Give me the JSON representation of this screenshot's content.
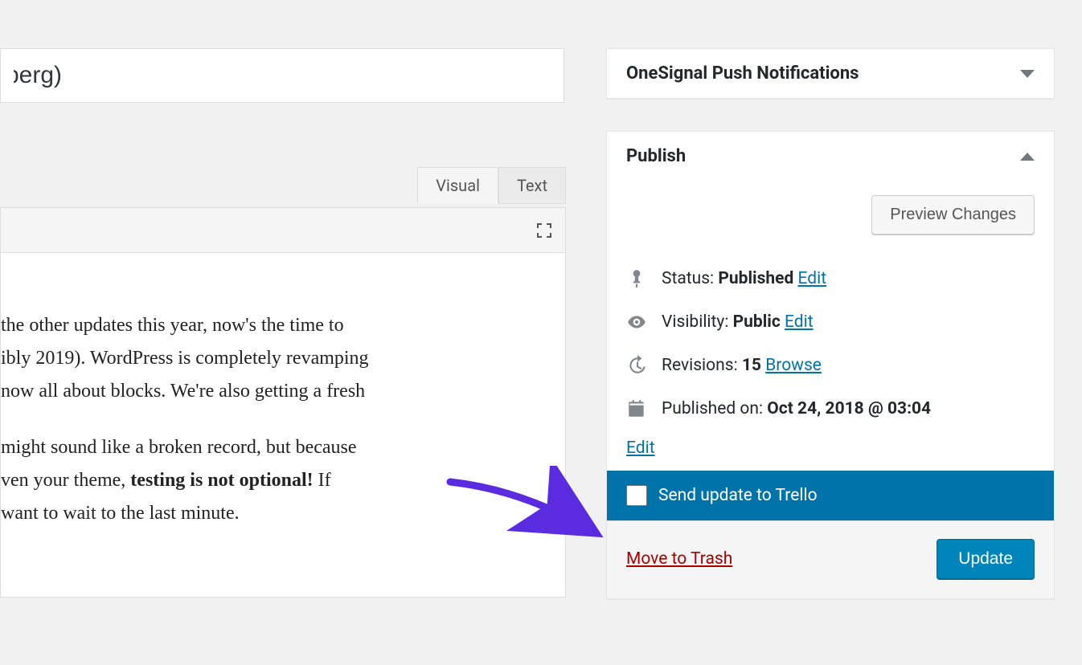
{
  "title_fragment": "berg)",
  "editor": {
    "tab_visual": "Visual",
    "tab_text": "Text",
    "para1_prefix": " the other updates this year, now's the time to ",
    "para1_line2": "ibly 2019). WordPress is completely revamping ",
    "para1_line3": "now all about blocks. We're also getting a fresh ",
    "para2_prefix": "might sound like a broken record, but because ",
    "para2_line2_a": "ven your theme, ",
    "para2_strong": "testing is not optional!",
    "para2_line2_b": " If ",
    "para2_line3": "want to wait to the last minute."
  },
  "sidebar": {
    "onesignal_title": "OneSignal Push Notifications",
    "publish_title": "Publish",
    "preview_button": "Preview Changes",
    "status_label": "Status: ",
    "status_value": "Published",
    "status_edit": "Edit",
    "visibility_label": "Visibility: ",
    "visibility_value": "Public",
    "visibility_edit": "Edit",
    "revisions_label": "Revisions: ",
    "revisions_value": "15",
    "revisions_browse": "Browse",
    "published_label": "Published on: ",
    "published_value": "Oct 24, 2018 @ 03:04",
    "published_edit": "Edit",
    "trello_label": "Send update to Trello",
    "trash_link": "Move to Trash",
    "update_button": "Update"
  }
}
